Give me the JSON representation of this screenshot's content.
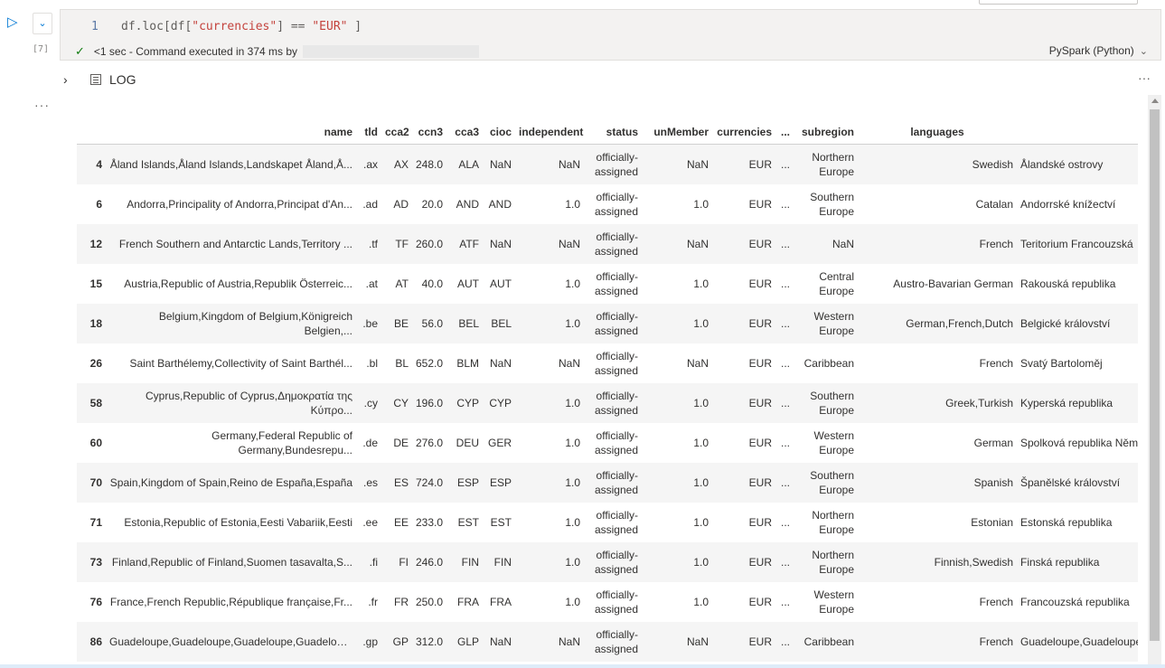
{
  "cell": {
    "execution_count": "[7]",
    "line_number": "1",
    "code_prefix": "df.loc[df[",
    "code_key": "\"currencies\"",
    "code_middle": "] == ",
    "code_value": "\"EUR\"",
    "code_suffix": " ]",
    "status_text": "<1 sec - Command executed in 374 ms by",
    "language": "PySpark (Python)"
  },
  "output": {
    "log_label": "LOG"
  },
  "table": {
    "columns": [
      "",
      "name",
      "tld",
      "cca2",
      "ccn3",
      "cca3",
      "cioc",
      "independent",
      "status",
      "unMember",
      "currencies",
      "...",
      "subregion",
      "languages",
      ""
    ],
    "rows": [
      [
        "4",
        "Åland Islands,Åland Islands,Landskapet Åland,Å...",
        ".ax",
        "AX",
        "248.0",
        "ALA",
        "NaN",
        "NaN",
        "officially-assigned",
        "NaN",
        "EUR",
        "...",
        "Northern Europe",
        "Swedish",
        "Ålandské ostrovy"
      ],
      [
        "6",
        "Andorra,Principality of Andorra,Principat d'An...",
        ".ad",
        "AD",
        "20.0",
        "AND",
        "AND",
        "1.0",
        "officially-assigned",
        "1.0",
        "EUR",
        "...",
        "Southern Europe",
        "Catalan",
        "Andorrské knížectví"
      ],
      [
        "12",
        "French Southern and Antarctic Lands,Territory ...",
        ".tf",
        "TF",
        "260.0",
        "ATF",
        "NaN",
        "NaN",
        "officially-assigned",
        "NaN",
        "EUR",
        "...",
        "NaN",
        "French",
        "Teritorium Francouzská"
      ],
      [
        "15",
        "Austria,Republic of Austria,Republik Österreic...",
        ".at",
        "AT",
        "40.0",
        "AUT",
        "AUT",
        "1.0",
        "officially-assigned",
        "1.0",
        "EUR",
        "...",
        "Central Europe",
        "Austro-Bavarian German",
        "Rakouská republika"
      ],
      [
        "18",
        "Belgium,Kingdom of Belgium,Königreich Belgien,...",
        ".be",
        "BE",
        "56.0",
        "BEL",
        "BEL",
        "1.0",
        "officially-assigned",
        "1.0",
        "EUR",
        "...",
        "Western Europe",
        "German,French,Dutch",
        "Belgické království"
      ],
      [
        "26",
        "Saint Barthélemy,Collectivity of Saint Barthél...",
        ".bl",
        "BL",
        "652.0",
        "BLM",
        "NaN",
        "NaN",
        "officially-assigned",
        "NaN",
        "EUR",
        "...",
        "Caribbean",
        "French",
        "Svatý Bartoloměj"
      ],
      [
        "58",
        "Cyprus,Republic of Cyprus,Δημοκρατία της Κύπρο...",
        ".cy",
        "CY",
        "196.0",
        "CYP",
        "CYP",
        "1.0",
        "officially-assigned",
        "1.0",
        "EUR",
        "...",
        "Southern Europe",
        "Greek,Turkish",
        "Kyperská republika"
      ],
      [
        "60",
        "Germany,Federal Republic of Germany,Bundesrepu...",
        ".de",
        "DE",
        "276.0",
        "DEU",
        "GER",
        "1.0",
        "officially-assigned",
        "1.0",
        "EUR",
        "...",
        "Western Europe",
        "German",
        "Spolková republika Německo"
      ],
      [
        "70",
        "Spain,Kingdom of Spain,Reino de España,España",
        ".es",
        "ES",
        "724.0",
        "ESP",
        "ESP",
        "1.0",
        "officially-assigned",
        "1.0",
        "EUR",
        "...",
        "Southern Europe",
        "Spanish",
        "Španělské království"
      ],
      [
        "71",
        "Estonia,Republic of Estonia,Eesti Vabariik,Eesti",
        ".ee",
        "EE",
        "233.0",
        "EST",
        "EST",
        "1.0",
        "officially-assigned",
        "1.0",
        "EUR",
        "...",
        "Northern Europe",
        "Estonian",
        "Estonská republika"
      ],
      [
        "73",
        "Finland,Republic of Finland,Suomen tasavalta,S...",
        ".fi",
        "FI",
        "246.0",
        "FIN",
        "FIN",
        "1.0",
        "officially-assigned",
        "1.0",
        "EUR",
        "...",
        "Northern Europe",
        "Finnish,Swedish",
        "Finská republika"
      ],
      [
        "76",
        "France,French Republic,République française,Fr...",
        ".fr",
        "FR",
        "250.0",
        "FRA",
        "FRA",
        "1.0",
        "officially-assigned",
        "1.0",
        "EUR",
        "...",
        "Western Europe",
        "French",
        "Francouzská republika"
      ],
      [
        "86",
        "Guadeloupe,Guadeloupe,Guadeloupe,Guadeloupe",
        ".gp",
        "GP",
        "312.0",
        "GLP",
        "NaN",
        "NaN",
        "officially-assigned",
        "NaN",
        "EUR",
        "...",
        "Caribbean",
        "French",
        "Guadeloupe,Guadeloupe"
      ]
    ]
  }
}
